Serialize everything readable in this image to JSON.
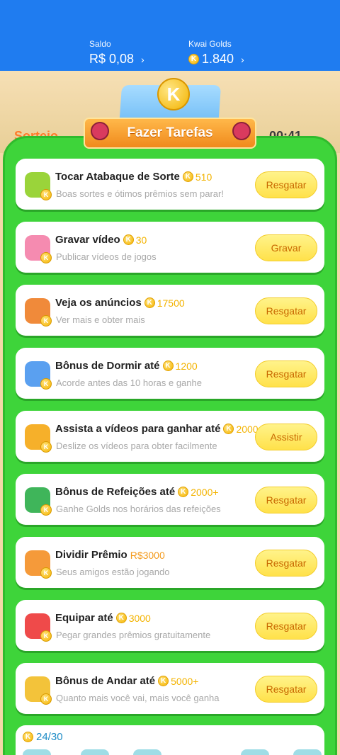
{
  "header": {
    "saldo_label": "Saldo",
    "saldo_value": "R$ 0,08",
    "golds_label": "Kwai Golds",
    "golds_value": "1.840",
    "chevron": "›"
  },
  "banner": {
    "coin_letter": "K",
    "title": "Fazer Tarefas"
  },
  "tasks": [
    {
      "title": "Tocar Atabaque de Sorte",
      "reward": "510",
      "desc": "Boas sortes e ótimos prêmios sem parar!",
      "button": "Resgatar",
      "icon": "drum-icon",
      "color": "#9ad43a"
    },
    {
      "title": "Gravar vídeo",
      "reward": "30",
      "desc": "Publicar vídeos de jogos",
      "button": "Gravar",
      "icon": "camera-icon",
      "color": "#f58bb0"
    },
    {
      "title": "Veja os anúncios",
      "reward": "17500",
      "desc": "Ver mais e obter mais",
      "button": "Resgatar",
      "icon": "tv-icon",
      "color": "#f08a3a"
    },
    {
      "title": "Bônus de Dormir até",
      "reward": "1200",
      "desc": "Acorde antes das 10 horas e ganhe",
      "button": "Resgatar",
      "icon": "moon-icon",
      "color": "#5aa0f0"
    },
    {
      "title": "Assista a vídeos para ganhar até",
      "reward": "2000",
      "desc": "Deslize os vídeos para obter facilmente",
      "button": "Assistir",
      "icon": "video-camera-icon",
      "color": "#f6b02a"
    },
    {
      "title": "Bônus de Refeições até",
      "reward": "2000+",
      "desc": "Ganhe Golds nos horários das refeições",
      "button": "Resgatar",
      "icon": "calendar-icon",
      "color": "#3fb55a"
    },
    {
      "title": "Dividir Prêmio",
      "reward": "R$3000",
      "desc": "Seus amigos estão jogando",
      "button": "Resgatar",
      "icon": "gift-icon",
      "color": "#f59a3a",
      "money": true
    },
    {
      "title": "Equipar até",
      "reward": "3000",
      "desc": "Pegar grandes prêmios gratuitamente",
      "button": "Resgatar",
      "icon": "boxing-glove-icon",
      "color": "#ef4a4a"
    },
    {
      "title": "Bônus de Andar até",
      "reward": "5000+",
      "desc": "Quanto mais você vai, mais você ganha",
      "button": "Resgatar",
      "icon": "walking-boy-icon",
      "color": "#f3c33a"
    }
  ],
  "progress": {
    "count": "24/30"
  },
  "colors": {
    "header_blue": "#1f7cf0",
    "board_green": "#3ed43a",
    "button_yellow": "#ffe14a",
    "button_text": "#c86700",
    "gold": "#f3b300"
  }
}
